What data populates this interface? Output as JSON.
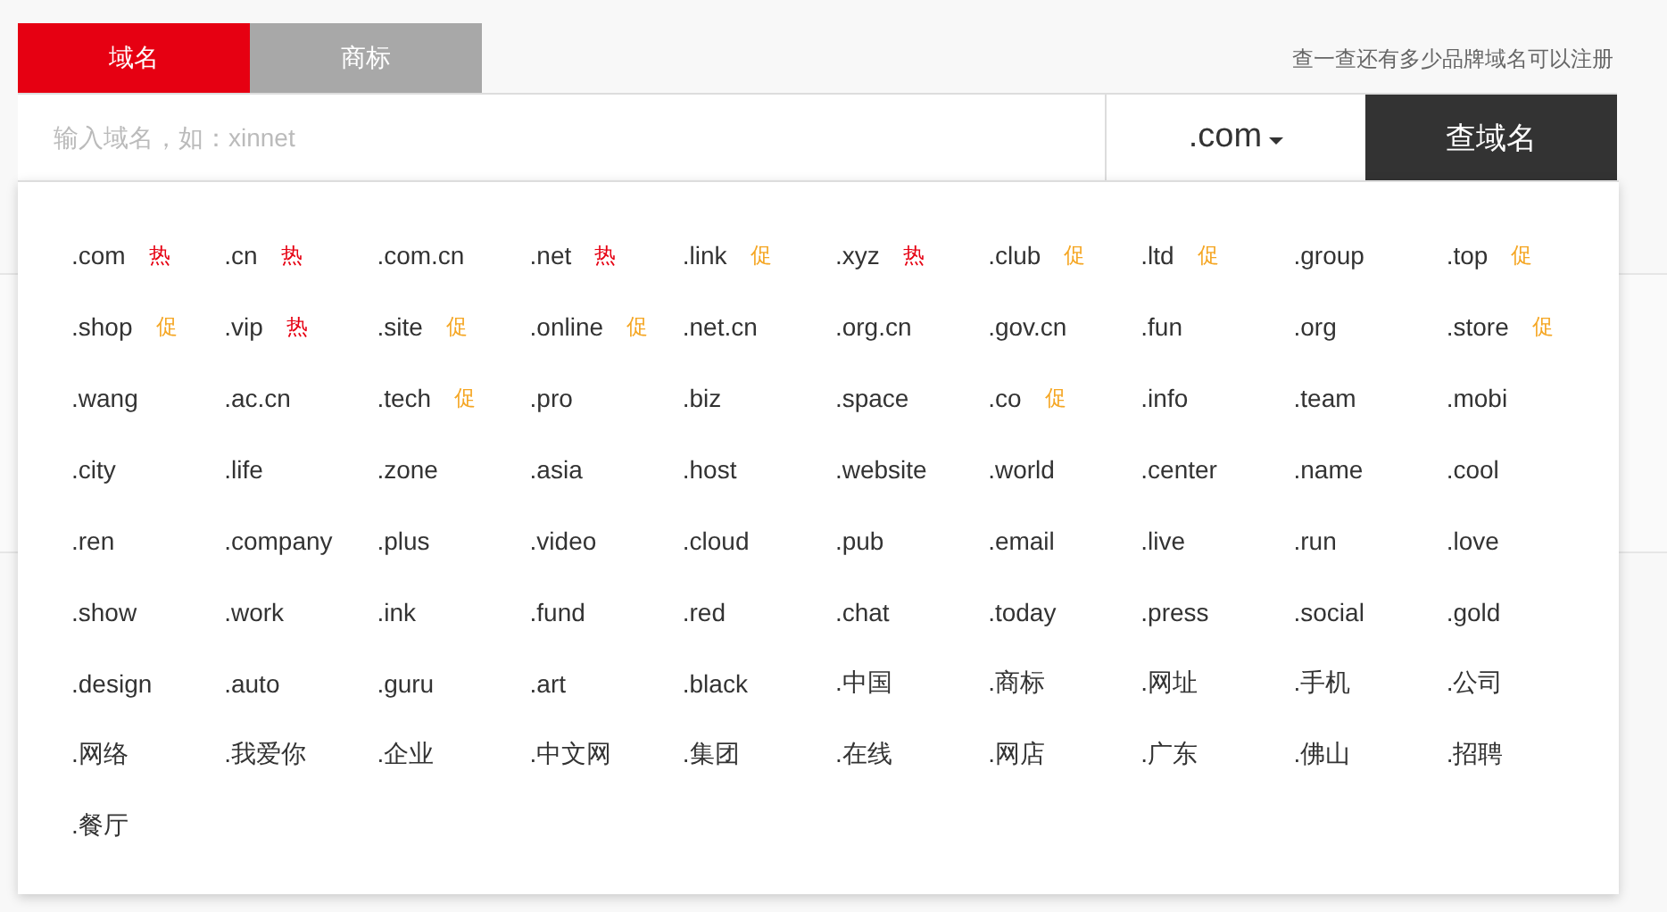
{
  "tabs": [
    {
      "label": "域名",
      "selected": true
    },
    {
      "label": "商标",
      "selected": false
    }
  ],
  "hint": "查一查还有多少品牌域名可以注册",
  "search": {
    "placeholder": "输入域名，如：xinnet",
    "suffix": ".com",
    "button": "查域名"
  },
  "suffixes": [
    {
      "name": ".com",
      "tag": "热",
      "kind": "hot"
    },
    {
      "name": ".cn",
      "tag": "热",
      "kind": "hot"
    },
    {
      "name": ".com.cn"
    },
    {
      "name": ".net",
      "tag": "热",
      "kind": "hot"
    },
    {
      "name": ".link",
      "tag": "促",
      "kind": "promo"
    },
    {
      "name": ".xyz",
      "tag": "热",
      "kind": "hot"
    },
    {
      "name": ".club",
      "tag": "促",
      "kind": "promo"
    },
    {
      "name": ".ltd",
      "tag": "促",
      "kind": "promo"
    },
    {
      "name": ".group"
    },
    {
      "name": ".top",
      "tag": "促",
      "kind": "promo"
    },
    {
      "name": ".shop",
      "tag": "促",
      "kind": "promo"
    },
    {
      "name": ".vip",
      "tag": "热",
      "kind": "hot"
    },
    {
      "name": ".site",
      "tag": "促",
      "kind": "promo"
    },
    {
      "name": ".online",
      "tag": "促",
      "kind": "promo"
    },
    {
      "name": ".net.cn"
    },
    {
      "name": ".org.cn"
    },
    {
      "name": ".gov.cn"
    },
    {
      "name": ".fun"
    },
    {
      "name": ".org"
    },
    {
      "name": ".store",
      "tag": "促",
      "kind": "promo"
    },
    {
      "name": ".wang"
    },
    {
      "name": ".ac.cn"
    },
    {
      "name": ".tech",
      "tag": "促",
      "kind": "promo"
    },
    {
      "name": ".pro"
    },
    {
      "name": ".biz"
    },
    {
      "name": ".space"
    },
    {
      "name": ".co",
      "tag": "促",
      "kind": "promo"
    },
    {
      "name": ".info"
    },
    {
      "name": ".team"
    },
    {
      "name": ".mobi"
    },
    {
      "name": ".city"
    },
    {
      "name": ".life"
    },
    {
      "name": ".zone"
    },
    {
      "name": ".asia"
    },
    {
      "name": ".host"
    },
    {
      "name": ".website"
    },
    {
      "name": ".world"
    },
    {
      "name": ".center"
    },
    {
      "name": ".name"
    },
    {
      "name": ".cool"
    },
    {
      "name": ".ren"
    },
    {
      "name": ".company"
    },
    {
      "name": ".plus"
    },
    {
      "name": ".video"
    },
    {
      "name": ".cloud"
    },
    {
      "name": ".pub"
    },
    {
      "name": ".email"
    },
    {
      "name": ".live"
    },
    {
      "name": ".run"
    },
    {
      "name": ".love"
    },
    {
      "name": ".show"
    },
    {
      "name": ".work"
    },
    {
      "name": ".ink"
    },
    {
      "name": ".fund"
    },
    {
      "name": ".red"
    },
    {
      "name": ".chat"
    },
    {
      "name": ".today"
    },
    {
      "name": ".press"
    },
    {
      "name": ".social"
    },
    {
      "name": ".gold"
    },
    {
      "name": ".design"
    },
    {
      "name": ".auto"
    },
    {
      "name": ".guru"
    },
    {
      "name": ".art"
    },
    {
      "name": ".black"
    },
    {
      "name": ".中国"
    },
    {
      "name": ".商标"
    },
    {
      "name": ".网址"
    },
    {
      "name": ".手机"
    },
    {
      "name": ".公司"
    },
    {
      "name": ".网络"
    },
    {
      "name": ".我爱你"
    },
    {
      "name": ".企业"
    },
    {
      "name": ".中文网"
    },
    {
      "name": ".集团"
    },
    {
      "name": ".在线"
    },
    {
      "name": ".网店"
    },
    {
      "name": ".广东"
    },
    {
      "name": ".佛山"
    },
    {
      "name": ".招聘"
    },
    {
      "name": ".餐厅"
    }
  ]
}
